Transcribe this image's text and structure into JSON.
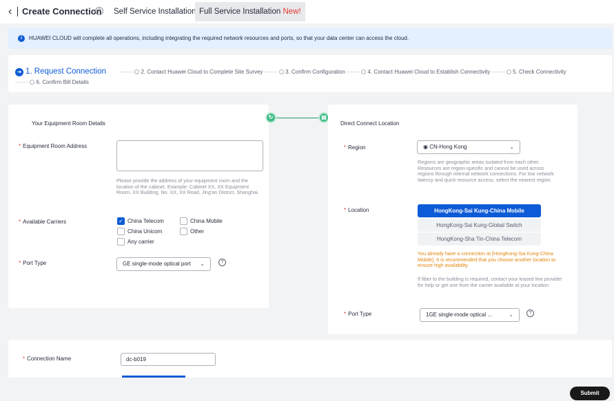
{
  "header": {
    "title": "Create Connection",
    "tabs": {
      "self_service": "Self Service Installation",
      "full_service": "Full Service Installation",
      "full_service_badge": "New!"
    }
  },
  "banner": {
    "text": "HUAWEI CLOUD will complete all operations, including integrating the required network resources and ports, so that your data center can access the cloud."
  },
  "steps": {
    "step1": "1. Request Connection",
    "dashes": "------",
    "step2": "2. Contact Huawei Cloud to Complete Site Survey",
    "step3": "3. Confirm Configuration",
    "step4": "4. Contact Huawei Cloud to Establish Connectivity",
    "step5": "5. Check Connectivity",
    "step6": "6. Confirm Bill Details"
  },
  "left": {
    "title": "Your Equipment Room Details",
    "address_label": "Equipment Room Address",
    "address_value": "",
    "address_help": "Please provide the address of your equipment room and the location of the cabinet. Example: Cabinet XX, XX Equipment Room, XX Building, No. XX, XX Road, Jing'an District, Shanghai.",
    "carriers_label": "Available Carriers",
    "carriers": {
      "china_telecom": "China Telecom",
      "china_mobile": "China Mobile",
      "china_unicom": "China Unicom",
      "other": "Other",
      "any": "Any carrier"
    },
    "port_type_label": "Port Type",
    "port_type_value": "GE single-mode optical port"
  },
  "right": {
    "title": "Direct Connect Location",
    "region_label": "Region",
    "region_value": "CN-Hong Kong",
    "region_help": "Regions are geographic areas isolated from each other. Resources are region-specific and cannot be used across regions through internal network connections. For low network latency and quick resource access, select the nearest region.",
    "location_label": "Location",
    "locations": [
      "HongKong-Sai Kung-China Mobile",
      "HongKong-Sai Kung-Global Switch",
      "HongKong-Sha Tin-China Telecom"
    ],
    "location_warning": "You already have a connection at [HongKong-Sai Kung-China Mobile]. It is recommended that you choose another location to ensure high availability.",
    "location_help": "If fiber to the building is required, contact your leased line provider for help or get one from the carrier available at your location.",
    "port_type_label": "Port Type",
    "port_type_value": "1GE single-mode optical ..."
  },
  "bottom": {
    "conn_name_label": "Connection Name",
    "conn_name_value": "dc-b019"
  },
  "submit_label": "Submit",
  "colors": {
    "primary": "#0d5bd6",
    "required": "#e0372e",
    "warning": "#e3840a",
    "success": "#3ebd86"
  },
  "icons": {
    "back": "chevron-left-icon",
    "help": "question-circle-icon",
    "info": "info-icon",
    "step_active": "arrow-right-circle-icon",
    "node_left": "cloud-connect-icon",
    "node_right": "location-icon",
    "pin": "pin-icon",
    "chevron": "chevron-down-icon",
    "check": "check-icon"
  }
}
